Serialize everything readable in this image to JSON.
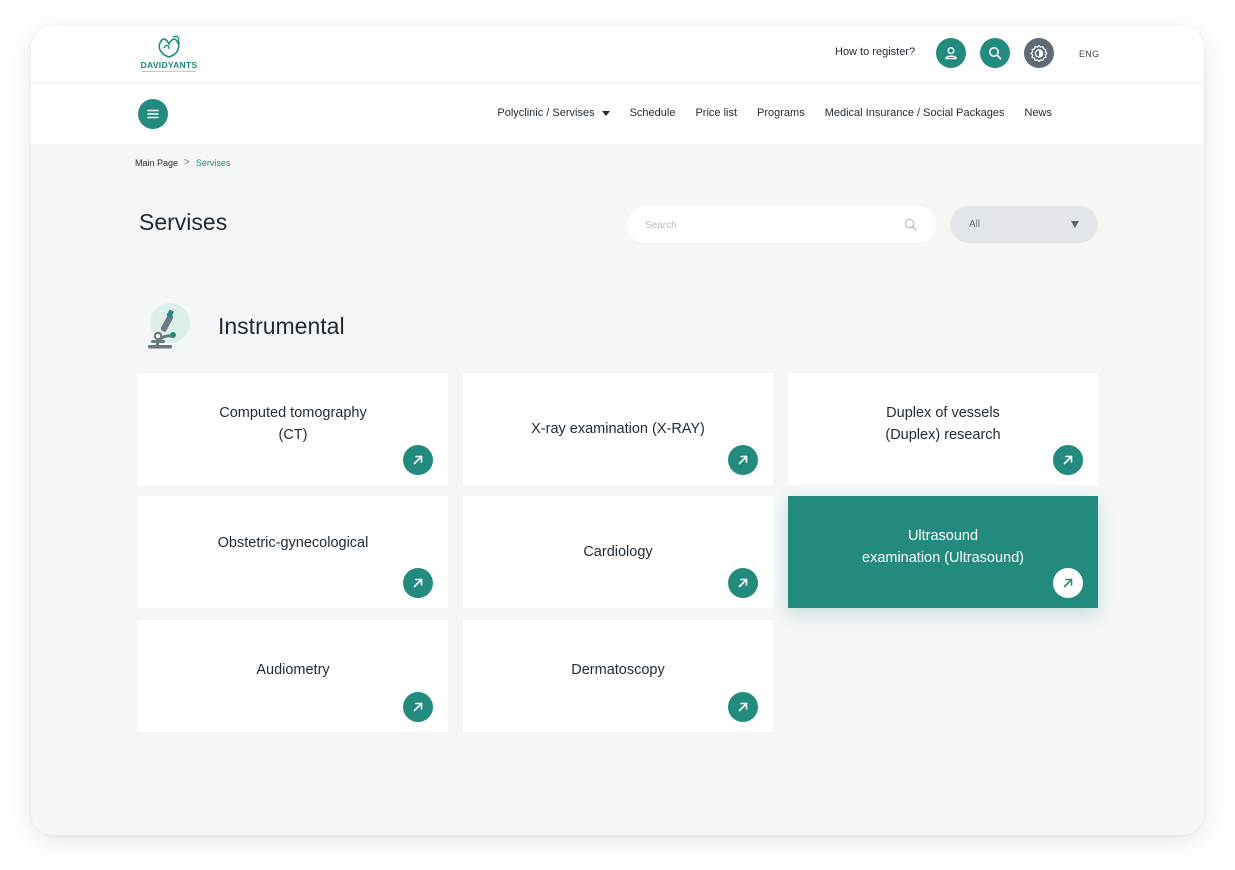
{
  "brand": {
    "name": "DAVIDYANTS"
  },
  "header": {
    "how_to_register": "How to register?",
    "language": "ENG",
    "icons": {
      "user": "user-icon",
      "search": "search-icon",
      "contrast": "contrast-icon"
    }
  },
  "nav": {
    "menu_icon": "hamburger-icon",
    "items": [
      {
        "label": "Polyclinic / Servises",
        "has_dropdown": true
      },
      {
        "label": "Schedule",
        "has_dropdown": false
      },
      {
        "label": "Price list",
        "has_dropdown": false
      },
      {
        "label": "Programs",
        "has_dropdown": false
      },
      {
        "label": "Medical Insurance / Social Packages",
        "has_dropdown": false
      },
      {
        "label": "News",
        "has_dropdown": false
      }
    ]
  },
  "breadcrumb": {
    "home": "Main Page",
    "separator": ">",
    "current": "Servises"
  },
  "page": {
    "title": "Servises"
  },
  "filters": {
    "search_placeholder": "Search",
    "search_value": "",
    "category_selected": "All"
  },
  "section": {
    "title": "Instrumental",
    "icon": "microscope-icon",
    "cards": [
      {
        "label": "Computed tomography\n(CT)",
        "active": false
      },
      {
        "label": "X-ray examination (X-RAY)",
        "active": false
      },
      {
        "label": "Duplex of vessels\n(Duplex) research",
        "active": false
      },
      {
        "label": "Obstetric-gynecological",
        "active": false
      },
      {
        "label": "Cardiology",
        "active": false
      },
      {
        "label": "Ultrasound\nexamination (Ultrasound)",
        "active": true
      },
      {
        "label": "Audiometry",
        "active": false
      },
      {
        "label": "Dermatoscopy",
        "active": false
      }
    ]
  },
  "colors": {
    "accent": "#238b7e",
    "text": "#1f2a33",
    "background": "#f4f6f8",
    "card": "#ffffff",
    "select_bg": "#e3e7ec",
    "contrast_btn": "#5f6b74"
  }
}
